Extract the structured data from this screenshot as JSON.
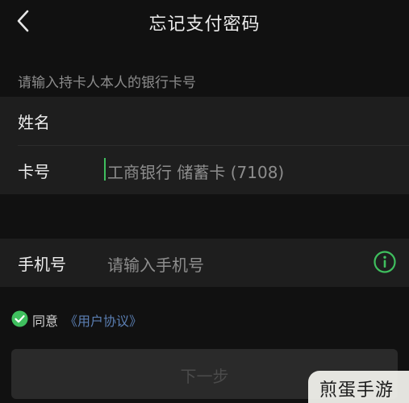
{
  "nav": {
    "title": "忘记支付密码"
  },
  "hint": "请输入持卡人本人的银行卡号",
  "card_info": {
    "name_label": "姓名",
    "name_value": "",
    "card_label": "卡号",
    "card_value": "工商银行 储蓄卡 (7108)"
  },
  "phone": {
    "label": "手机号",
    "placeholder": "请输入手机号"
  },
  "agreement": {
    "agree_text": "同意",
    "link_text": "《用户协议》"
  },
  "next_button": {
    "label": "下一步"
  },
  "watermark": {
    "text": "煎蛋手游"
  },
  "colors": {
    "background": "#111111",
    "card": "#1e1e1e",
    "accent_green": "#3fbf5e",
    "link_blue": "#5b7fb3"
  }
}
